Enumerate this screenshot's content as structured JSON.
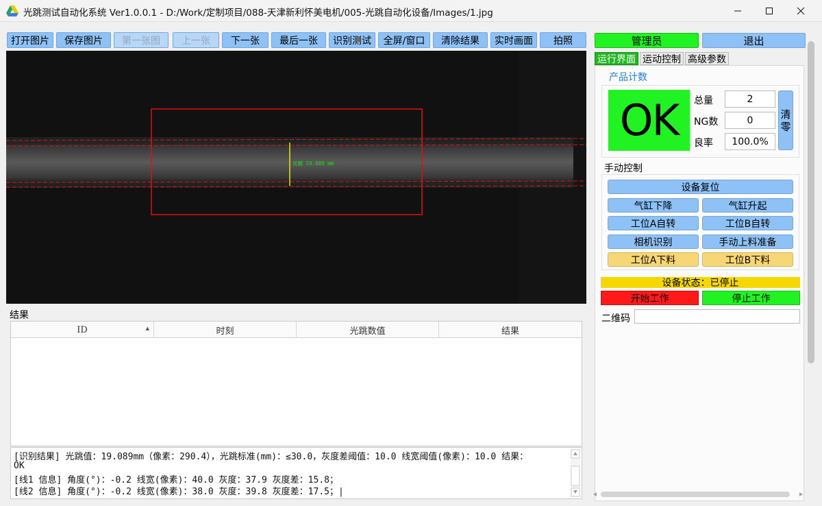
{
  "window": {
    "title": "光跳测试自动化系统 Ver1.0.0.1 - D:/Work/定制项目/088-天津新利怀美电机/005-光跳自动化设备/Images/1.jpg"
  },
  "toolbar": {
    "open_image": "打开图片",
    "save_image": "保存图片",
    "first_image": "第一张图",
    "prev_image": "上一张",
    "next_image": "下一张",
    "last_image": "最后一张",
    "recognize_test": "识别测试",
    "fullscreen_window": "全屏/窗口",
    "clear_results": "清除结果",
    "live_view": "实时画面",
    "capture": "拍照"
  },
  "viewer": {
    "measure_label": "光跳 19.089 mm",
    "colors": {
      "roi": "#e01010",
      "line": "#d81818",
      "marker": "#e8e800",
      "text": "#19e019"
    }
  },
  "results": {
    "label": "结果",
    "columns": [
      "ID",
      "时刻",
      "光跳数值",
      "结果"
    ],
    "rows": []
  },
  "log": {
    "lines": [
      "[识别结果] 光跳值：19.089mm（像素：290.4），光跳标准(mm)：≤30.0，灰度差阈值：10.0 线宽阈值(像素)：10.0 结果：",
      "OK",
      "[线1 信息] 角度(°)：-0.2 线宽(像素)：40.0 灰度：37.9 灰度差：15.8；",
      "[线2 信息] 角度(°)：-0.2 线宽(像素)：38.0 灰度：39.8 灰度差：17.5；|"
    ]
  },
  "user": {
    "admin_label": "管理员",
    "logout_label": "退出"
  },
  "tabs": [
    "运行界面",
    "运动控制",
    "高级参数"
  ],
  "counter": {
    "title": "产品计数",
    "status": "OK",
    "total_label": "总量",
    "total_value": "2",
    "ng_label": "NG数",
    "ng_value": "0",
    "yield_label": "良率",
    "yield_value": "100.0%",
    "clear_label_top": "清",
    "clear_label_bottom": "零"
  },
  "manual": {
    "title": "手动控制",
    "reset": "设备复位",
    "cylinder_down": "气缸下降",
    "cylinder_up": "气缸升起",
    "station_a_rotate": "工位A自转",
    "station_b_rotate": "工位B自转",
    "camera_recognize": "相机识别",
    "manual_load_prepare": "手动上料准备",
    "station_a_unload": "工位A下料",
    "station_b_unload": "工位B下料"
  },
  "device": {
    "status_text": "设备状态：已停止",
    "start_label": "开始工作",
    "stop_label": "停止工作",
    "qr_label": "二维码",
    "qr_value": ""
  }
}
